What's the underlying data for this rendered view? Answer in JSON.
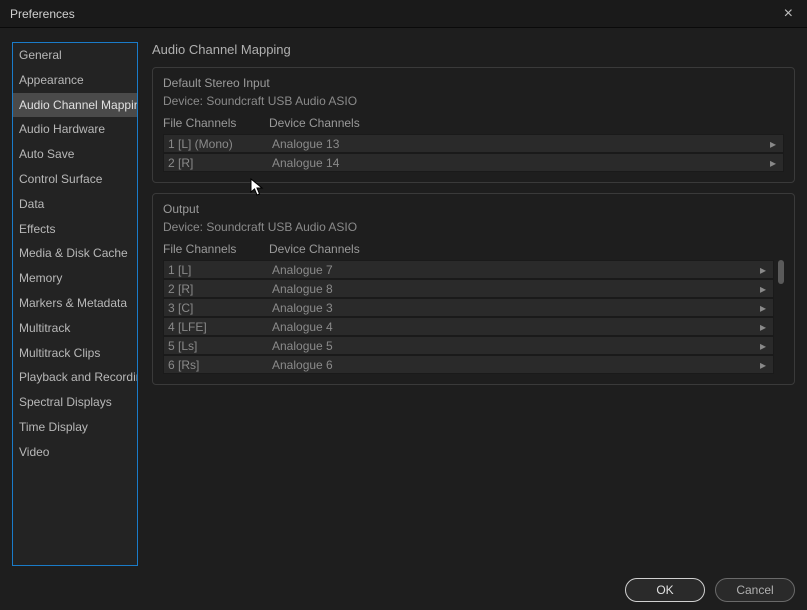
{
  "window": {
    "title": "Preferences"
  },
  "sidebar": {
    "items": [
      {
        "label": "General"
      },
      {
        "label": "Appearance"
      },
      {
        "label": "Audio Channel Mapping",
        "selected": true
      },
      {
        "label": "Audio Hardware"
      },
      {
        "label": "Auto Save"
      },
      {
        "label": "Control Surface"
      },
      {
        "label": "Data"
      },
      {
        "label": "Effects"
      },
      {
        "label": "Media & Disk Cache"
      },
      {
        "label": "Memory"
      },
      {
        "label": "Markers & Metadata"
      },
      {
        "label": "Multitrack"
      },
      {
        "label": "Multitrack Clips"
      },
      {
        "label": "Playback and Recording"
      },
      {
        "label": "Spectral Displays"
      },
      {
        "label": "Time Display"
      },
      {
        "label": "Video"
      }
    ]
  },
  "main": {
    "title": "Audio Channel Mapping",
    "input_section": {
      "title": "Default Stereo Input",
      "device_label": "Device: Soundcraft USB Audio ASIO",
      "file_header": "File Channels",
      "device_header": "Device Channels",
      "rows": [
        {
          "file": "1 [L] (Mono)",
          "device": "Analogue 13"
        },
        {
          "file": "2 [R]",
          "device": "Analogue 14"
        }
      ]
    },
    "output_section": {
      "title": "Output",
      "device_label": "Device: Soundcraft USB Audio ASIO",
      "file_header": "File Channels",
      "device_header": "Device Channels",
      "rows": [
        {
          "file": "1 [L]",
          "device": "Analogue 7"
        },
        {
          "file": "2 [R]",
          "device": "Analogue 8"
        },
        {
          "file": "3 [C]",
          "device": "Analogue 3"
        },
        {
          "file": "4 [LFE]",
          "device": "Analogue 4"
        },
        {
          "file": "5 [Ls]",
          "device": "Analogue 5"
        },
        {
          "file": "6 [Rs]",
          "device": "Analogue 6"
        }
      ]
    }
  },
  "footer": {
    "ok": "OK",
    "cancel": "Cancel"
  }
}
